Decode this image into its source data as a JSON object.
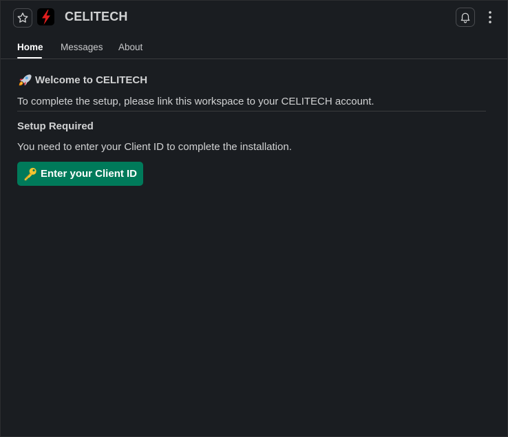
{
  "header": {
    "title": "CELITECH",
    "icons": {
      "star": "star-icon",
      "logo": "lightning-bolt-icon",
      "bell": "bell-icon",
      "more": "more-vertical-icon"
    },
    "logo_color": "#e01e1e"
  },
  "tabs": [
    {
      "label": "Home",
      "active": true
    },
    {
      "label": "Messages",
      "active": false
    },
    {
      "label": "About",
      "active": false
    }
  ],
  "content": {
    "welcome_emoji": "rocket-icon",
    "welcome_heading": "Welcome to CELITECH",
    "setup_text": "To complete the setup, please link this workspace to your CELITECH account.",
    "setup_required_heading": "Setup Required",
    "need_text": "You need to enter your Client ID to complete the installation.",
    "button": {
      "emoji": "key-icon",
      "label": "Enter your Client ID",
      "color": "#007a5a"
    }
  },
  "colors": {
    "background": "#1a1d21",
    "text": "#d1d2d3",
    "divider": "#3a3b3e"
  }
}
